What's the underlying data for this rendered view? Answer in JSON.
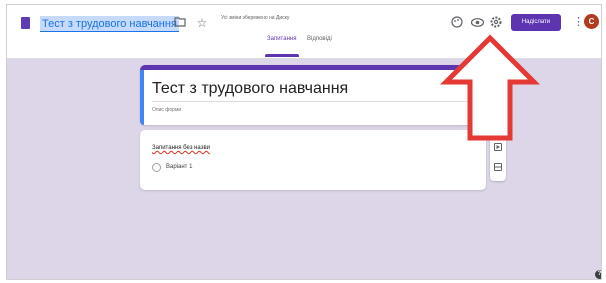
{
  "window": {
    "doc_title": "Тест з трудового навчання",
    "saved_note": "Усі зміни збережено на Диску",
    "send_label": "Надіслати",
    "avatar_letter": "C"
  },
  "tabs": [
    {
      "label": "Запитання",
      "active": true
    },
    {
      "label": "Відповіді",
      "active": false
    }
  ],
  "form": {
    "title": "Тест з трудового навчання",
    "description_placeholder": "Опис форми"
  },
  "question": {
    "title": "Запитання без назви",
    "option": "Варіант 1"
  },
  "icons": {
    "doc": "forms-doc-icon",
    "folder": "folder-icon",
    "star": "star-icon",
    "palette": "palette-icon",
    "preview": "eye-icon",
    "settings": "gear-icon",
    "more": "kebab-menu-icon",
    "help": "help-icon"
  },
  "colors": {
    "accent": "#5e35b1",
    "background": "#dcd6e8",
    "arrow": "#e53935"
  }
}
